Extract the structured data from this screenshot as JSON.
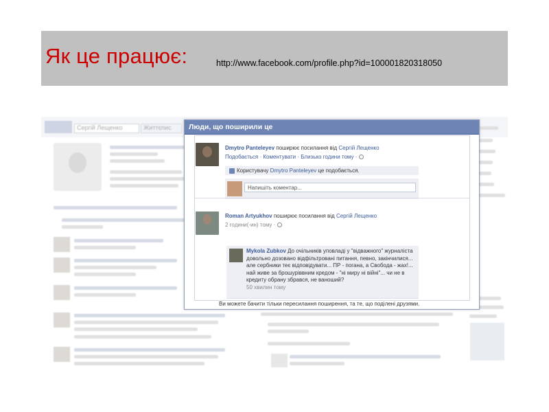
{
  "slide": {
    "title": "Як це працює:",
    "url": "http://www.facebook.com/profile.php?id=100001820318050"
  },
  "background_page": {
    "profile_name": "Сергій Лещенко",
    "nav_chip": "Життєпис"
  },
  "dialog": {
    "title": "Люди, що поширили це",
    "shares": [
      {
        "author": "Dmytro Panteleyev",
        "action": " поширює посилання від ",
        "source": "Сергій Лещенко",
        "actions": "Подобається · Коментувати · Близько години тому ·",
        "like_line_prefix": "Користувачу ",
        "like_line_name": "Dmytro Panteleyev",
        "like_line_suffix": " це подобається.",
        "comment_placeholder": "Напишіть коментар..."
      },
      {
        "author": "Roman Artyukhov",
        "action": " поширює посилання від ",
        "source": "Сергій Лещенко",
        "actions": "2 години(-ин) тому ·",
        "quote_author": "Mykola Zubkov",
        "quote_text": "До очільників уповладі у \"відважного\" журналіста довольно дозовано відфільтровані питання, певно, закінчилися... але сербники теє відповідувати... ПР - погана, а Свобода - жах!... най живе за брошуріввним кредом - \"ні миру ні війні\"... чи не в кредиту обрану збрався, не ваноший?",
        "quote_time": "50 хвилин тому"
      }
    ],
    "footer": "Ви можете бачити тільки пересилання поширення, та те, що поділені друзями."
  }
}
